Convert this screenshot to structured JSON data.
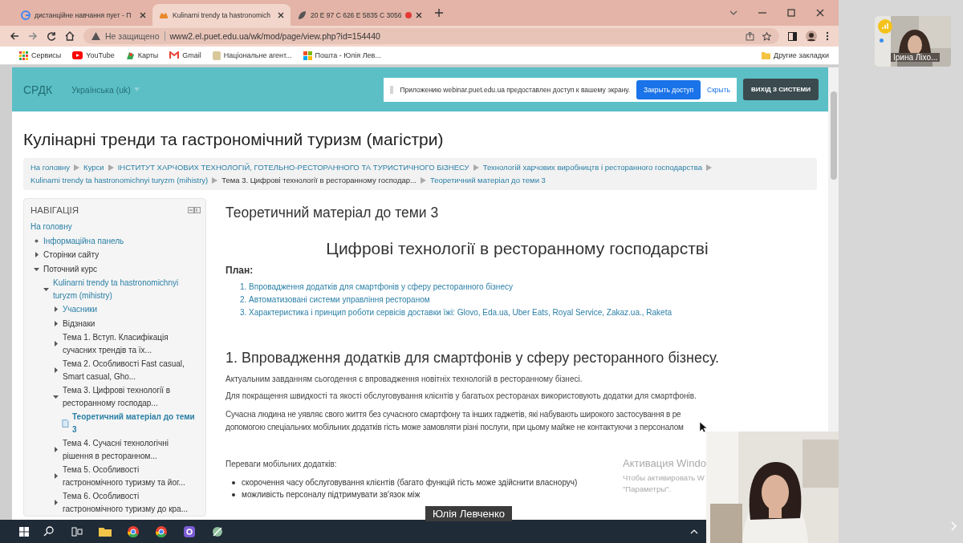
{
  "browser": {
    "tabs": [
      {
        "title": "дистанційне навчання пует - П",
        "selected": false,
        "recording": false
      },
      {
        "title": "Kulinarni trendy ta hastronomich",
        "selected": true,
        "recording": false
      },
      {
        "title": "20 E 97 C 626 E 5835 C 3056",
        "selected": false,
        "recording": true
      }
    ],
    "address": {
      "security": "Не защищено",
      "url": "www2.el.puet.edu.ua/wk/mod/page/view.php?id=154440"
    },
    "bookmarks": [
      "Сервисы",
      "YouTube",
      "Карты",
      "Gmail",
      "Національне агент...",
      "Пошта - Юлія Лев..."
    ],
    "other_bookmarks": "Другие закладки"
  },
  "header": {
    "brand": "СРДК",
    "language": "Українська (uk)",
    "notice": {
      "text": "Приложению webinar.puet.edu.ua предоставлен доступ к вашему экрану.",
      "stop_button": "Закрыть доступ",
      "hide_link": "Скрыть"
    },
    "logout_button": "ВИХІД З СИСТЕМИ"
  },
  "course_title": "Кулінарні тренди та гастрономічний туризм (магістри)",
  "breadcrumbs": [
    {
      "label": "На головну",
      "link": true
    },
    {
      "label": "Курси",
      "link": true
    },
    {
      "label": "ІНСТИТУТ ХАРЧОВИХ ТЕХНОЛОГІЙ, ГОТЕЛЬНО-РЕСТОРАННОГО ТА ТУРИСТИЧНОГО БІЗНЕСУ",
      "link": true
    },
    {
      "label": "Технологій харчових виробництв і ресторанного господарства",
      "link": true
    },
    {
      "label": "Kulinarni trendy ta hastronomichnyi turyzm (mihistry)",
      "link": true
    },
    {
      "label": "Тема 3. Цифрові технології в ресторанному господар...",
      "link": false
    },
    {
      "label": "Теоретичний матеріал до теми 3",
      "link": true
    }
  ],
  "navigation": {
    "title": "НАВІГАЦІЯ",
    "items": [
      {
        "label": "На головну",
        "kind": "root",
        "link": true,
        "selected": false,
        "children": [
          {
            "label": "Інформаційна панель",
            "kind": "item",
            "link": true,
            "selected": false
          },
          {
            "label": "Сторінки сайту",
            "kind": "branch",
            "expanded": false,
            "link": false,
            "selected": false
          },
          {
            "label": "Поточний курс",
            "kind": "branch",
            "expanded": true,
            "link": false,
            "selected": false,
            "children": [
              {
                "label": "Kulinarni trendy ta hastronomichnyi turyzm (mihistry)",
                "kind": "branch",
                "expanded": true,
                "link": true,
                "selected": false,
                "children": [
                  {
                    "label": "Учасники",
                    "kind": "branch",
                    "expanded": false,
                    "link": true,
                    "selected": false
                  },
                  {
                    "label": "Відзнаки",
                    "kind": "branch",
                    "expanded": false,
                    "link": false,
                    "selected": false
                  },
                  {
                    "label": "Тема 1. Вступ. Класифікація сучасних трендів та їх...",
                    "kind": "branch",
                    "expanded": false,
                    "link": false,
                    "selected": false
                  },
                  {
                    "label": "Тема 2. Особливості Fast casual, Smart casual, Gho...",
                    "kind": "branch",
                    "expanded": false,
                    "link": false,
                    "selected": false
                  },
                  {
                    "label": "Тема 3. Цифрові технології в ресторанному господар...",
                    "kind": "branch",
                    "expanded": true,
                    "link": false,
                    "selected": false,
                    "children": [
                      {
                        "label": "Теоретичний матеріал до теми 3",
                        "kind": "page",
                        "link": true,
                        "selected": true
                      }
                    ]
                  },
                  {
                    "label": "Тема 4. Сучасні технологічні рішення в ресторанном...",
                    "kind": "branch",
                    "expanded": false,
                    "link": false,
                    "selected": false
                  },
                  {
                    "label": "Тема 5. Особливості гастрономічного туризму та йог...",
                    "kind": "branch",
                    "expanded": false,
                    "link": false,
                    "selected": false
                  },
                  {
                    "label": "Тема 6. Особливості гастрономічного туризму до кра...",
                    "kind": "branch",
                    "expanded": false,
                    "link": false,
                    "selected": false
                  }
                ]
              }
            ]
          }
        ]
      }
    ]
  },
  "content": {
    "page_title": "Теоретичний матеріал до теми 3",
    "heading": "Цифрові технології в ресторанному господарстві",
    "plan_label": "План:",
    "plan": [
      "1. Впровадження додатків для смартфонів у сферу ресторанного бізнесу",
      "2. Автоматизовані системи управління рестораном",
      "3. Характеристика і принцип роботи сервісів доставки їжі: Glovo, Eda.ua, Uber Eats, Royal Service, Zakaz.ua., Raketa"
    ],
    "section_title": "1. Впровадження додатків для смартфонів у сферу ресторанного бізнесу.",
    "paragraphs": [
      "Актуальним завданням сьогодення є впровадження новітніх технологій в ресторанному бізнесі.",
      "Для покращення швидкості та якості обслуговування клієнтів у багатьох ресторанах використовують додатки для смартфонів."
    ],
    "cut_paragraph_lines": [
      "Сучасна людина не уявляє свого життя без сучасного смартфону та інших гаджетів, які набувають широкого застосування в ре",
      "допомогою спеціальних мобільних додатків гість може замовляти різні послуги, при цьому майже не контактуючи з персоналом"
    ],
    "advantages_label": "Переваги мобільних додатків:",
    "advantages": [
      "скорочення часу обслуговування клієнтів (багато функцій гість може здійснити власноруч)",
      "можливість персоналу підтримувати зв'язок між"
    ]
  },
  "os_notice": {
    "title": "Активация Windo",
    "lines": [
      "Чтобы активировать W",
      "\"Параметры\"."
    ]
  },
  "call": {
    "presenter_name": "Юлія Левченко",
    "participant_name": "Ірина Ліхо..."
  }
}
